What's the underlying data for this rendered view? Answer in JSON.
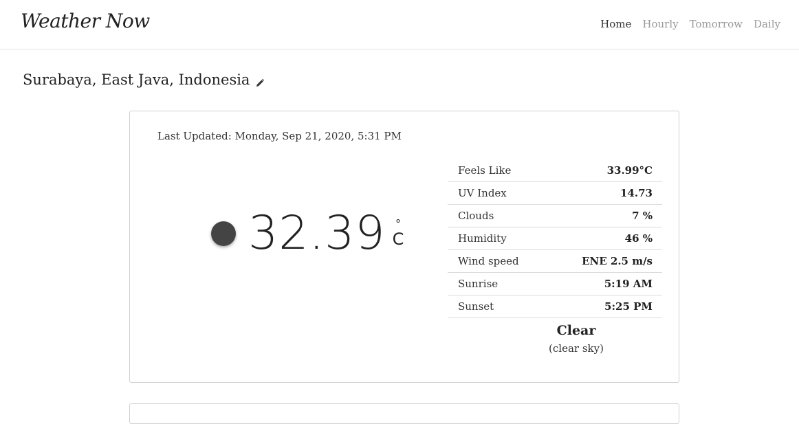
{
  "app": {
    "brand": "Weather Now"
  },
  "nav": {
    "items": [
      {
        "label": "Home",
        "active": true
      },
      {
        "label": "Hourly",
        "active": false
      },
      {
        "label": "Tomorrow",
        "active": false
      },
      {
        "label": "Daily",
        "active": false
      }
    ]
  },
  "location": {
    "name": "Surabaya, East Java, Indonesia",
    "edit_icon": "pencil-icon"
  },
  "current": {
    "last_updated": "Last Updated: Monday, Sep 21, 2020, 5:31 PM",
    "temperature": "32.39",
    "unit_degree": "°",
    "unit_letter": "C",
    "icon": "clear-sky-icon",
    "condition": "Clear",
    "description": "(clear sky)",
    "details": [
      {
        "label": "Feels Like",
        "value": "33.99°C"
      },
      {
        "label": "UV Index",
        "value": "14.73"
      },
      {
        "label": "Clouds",
        "value": "7 %"
      },
      {
        "label": "Humidity",
        "value": "46 %"
      },
      {
        "label": "Wind speed",
        "value": "ENE 2.5 m/s"
      },
      {
        "label": "Sunrise",
        "value": "5:19 AM"
      },
      {
        "label": "Sunset",
        "value": "5:25 PM"
      }
    ]
  },
  "colors": {
    "text": "#212529",
    "muted_nav": "#999999",
    "border": "#d0d0d0",
    "icon": "#444444"
  }
}
